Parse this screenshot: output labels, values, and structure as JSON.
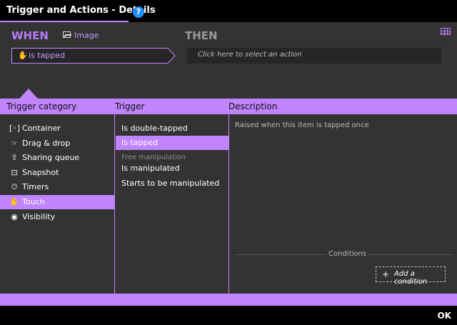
{
  "window": {
    "title": "Trigger and Actions - Details",
    "help_glyph": "?"
  },
  "when_section": {
    "heading": "WHEN",
    "object_icon": "image-icon",
    "object_label": "Image",
    "trigger_icon": "hand-icon",
    "trigger_value": "is tapped"
  },
  "then_section": {
    "heading": "THEN",
    "action_placeholder": "Click here to select an action"
  },
  "columns": {
    "category": "Trigger category",
    "trigger": "Trigger",
    "description": "Description"
  },
  "categories": [
    {
      "label": "Container",
      "icon": "container-icon",
      "glyph": "[◦]",
      "selected": false
    },
    {
      "label": "Drag & drop",
      "icon": "drag-hand-icon",
      "glyph": "☞",
      "selected": false
    },
    {
      "label": "Sharing queue",
      "icon": "sharing-queue-icon",
      "glyph": "⇧",
      "selected": false
    },
    {
      "label": "Snapshot",
      "icon": "snapshot-icon",
      "glyph": "⊡",
      "selected": false
    },
    {
      "label": "Timers",
      "icon": "timer-icon",
      "glyph": "⏱",
      "selected": false
    },
    {
      "label": "Touch",
      "icon": "hand-icon",
      "glyph": "✋",
      "selected": true
    },
    {
      "label": "Visibility",
      "icon": "eye-icon",
      "glyph": "◉",
      "selected": false
    }
  ],
  "triggers": {
    "items": [
      {
        "label": "Is double-tapped",
        "selected": false
      },
      {
        "label": "Is tapped",
        "selected": true
      },
      {
        "label": "Is manipulated",
        "selected": false
      },
      {
        "label": "Starts to be manipulated",
        "selected": false
      }
    ],
    "group_label": "Free manipulation"
  },
  "description_text": "Raised when this item is tapped once",
  "conditions": {
    "label": "Conditions",
    "add_label": "Add a condition",
    "add_glyph": "+"
  },
  "footer": {
    "ok_label": "OK"
  },
  "colors": {
    "accent": "#c084fc",
    "panel": "#333333",
    "background": "#000000"
  }
}
